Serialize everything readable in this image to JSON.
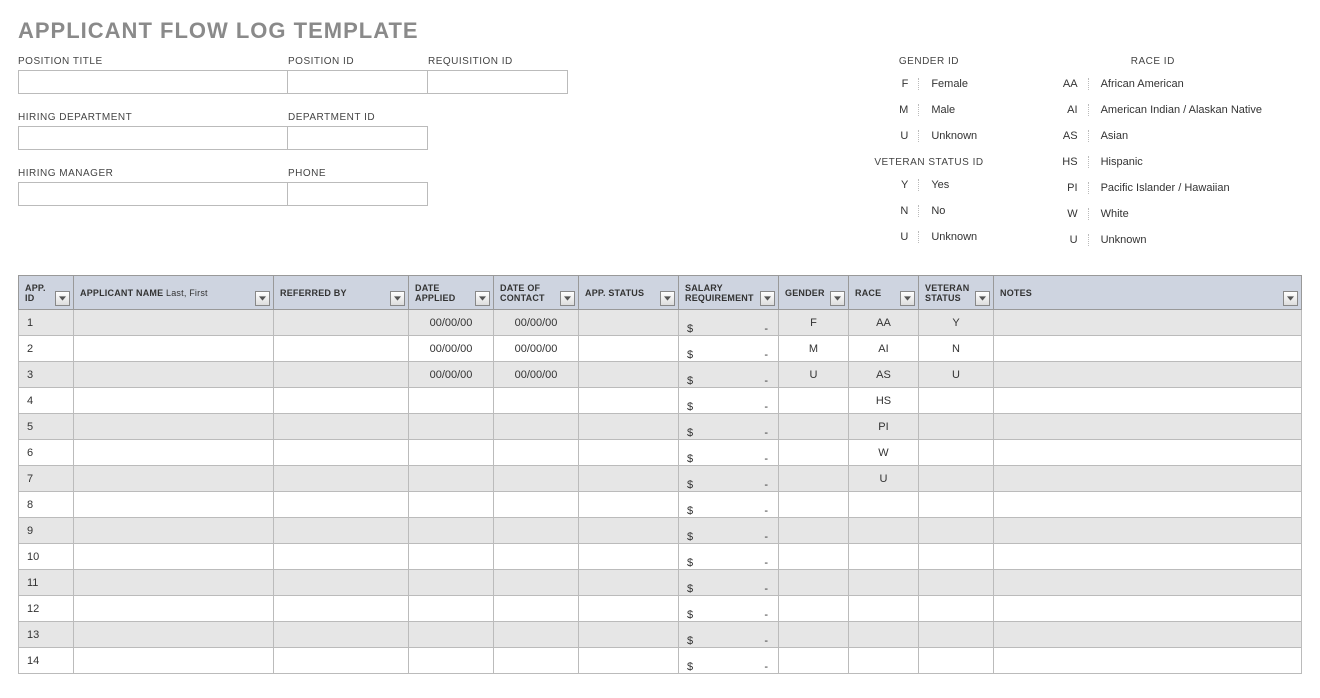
{
  "title": "APPLICANT FLOW LOG TEMPLATE",
  "fields": {
    "row1": [
      {
        "label": "POSITION TITLE",
        "cls": "w260"
      },
      {
        "label": "POSITION ID",
        "cls": "w140"
      },
      {
        "label": "REQUISITION ID",
        "cls": "w140"
      }
    ],
    "row2": [
      {
        "label": "HIRING DEPARTMENT",
        "cls": "w260"
      },
      {
        "label": "DEPARTMENT ID",
        "cls": "w140"
      }
    ],
    "row3": [
      {
        "label": "HIRING MANAGER",
        "cls": "w260"
      },
      {
        "label": "PHONE",
        "cls": "w140"
      }
    ]
  },
  "legends": {
    "gender": {
      "title": "GENDER ID",
      "rows": [
        {
          "code": "F",
          "label": "Female"
        },
        {
          "code": "M",
          "label": "Male"
        },
        {
          "code": "U",
          "label": "Unknown"
        }
      ]
    },
    "veteran": {
      "title": "VETERAN STATUS ID",
      "rows": [
        {
          "code": "Y",
          "label": "Yes"
        },
        {
          "code": "N",
          "label": "No"
        },
        {
          "code": "U",
          "label": "Unknown"
        }
      ]
    },
    "race": {
      "title": "RACE ID",
      "rows": [
        {
          "code": "AA",
          "label": "African American"
        },
        {
          "code": "AI",
          "label": "American Indian / Alaskan Native"
        },
        {
          "code": "AS",
          "label": "Asian"
        },
        {
          "code": "HS",
          "label": "Hispanic"
        },
        {
          "code": "PI",
          "label": "Pacific Islander / Hawaiian"
        },
        {
          "code": "W",
          "label": "White"
        },
        {
          "code": "U",
          "label": "Unknown"
        }
      ]
    }
  },
  "columns": [
    {
      "label": "APP. ID",
      "colcls": "c-id"
    },
    {
      "label": "APPLICANT NAME",
      "sub": " Last, First",
      "colcls": "c-name"
    },
    {
      "label": "REFERRED BY",
      "colcls": "c-ref"
    },
    {
      "label": "DATE APPLIED",
      "colcls": "c-date1"
    },
    {
      "label": "DATE OF CONTACT",
      "colcls": "c-date2"
    },
    {
      "label": "APP. STATUS",
      "colcls": "c-status"
    },
    {
      "label": "SALARY REQUIREMENT",
      "colcls": "c-sal"
    },
    {
      "label": "GENDER",
      "colcls": "c-gen"
    },
    {
      "label": "RACE",
      "colcls": "c-race"
    },
    {
      "label": "VETERAN STATUS",
      "colcls": "c-vet"
    },
    {
      "label": "NOTES",
      "colcls": "c-notes"
    }
  ],
  "cell_defaults": {
    "date_placeholder": "00/00/00",
    "salary_currency": "$",
    "salary_dash": "-"
  },
  "rows": [
    {
      "id": "1",
      "date_applied": "00/00/00",
      "date_contact": "00/00/00",
      "gender": "F",
      "race": "AA",
      "veteran": "Y"
    },
    {
      "id": "2",
      "date_applied": "00/00/00",
      "date_contact": "00/00/00",
      "gender": "M",
      "race": "AI",
      "veteran": "N"
    },
    {
      "id": "3",
      "date_applied": "00/00/00",
      "date_contact": "00/00/00",
      "gender": "U",
      "race": "AS",
      "veteran": "U"
    },
    {
      "id": "4",
      "race": "HS"
    },
    {
      "id": "5",
      "race": "PI"
    },
    {
      "id": "6",
      "race": "W"
    },
    {
      "id": "7",
      "race": "U"
    },
    {
      "id": "8"
    },
    {
      "id": "9"
    },
    {
      "id": "10"
    },
    {
      "id": "11"
    },
    {
      "id": "12"
    },
    {
      "id": "13"
    },
    {
      "id": "14"
    }
  ]
}
